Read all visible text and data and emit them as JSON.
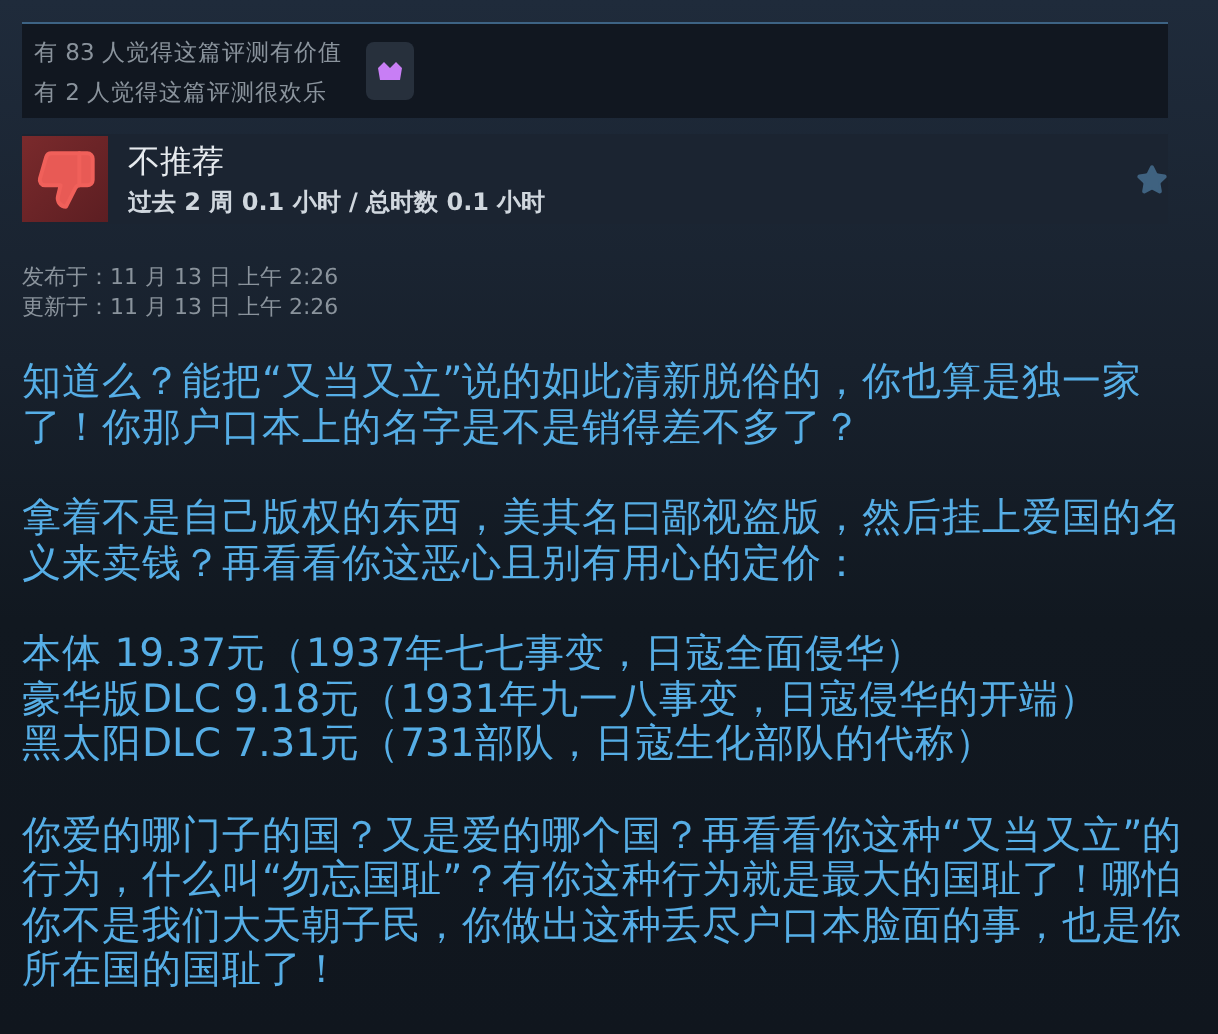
{
  "awards": {
    "helpful": "有 83 人觉得这篇评测有价值",
    "funny": "有 2 人觉得这篇评测很欢乐"
  },
  "review": {
    "recommended": false,
    "verdict": "不推荐",
    "hours": "过去 2 周 0.1 小时 / 总时数 0.1 小时"
  },
  "dates": {
    "posted": "发布于：11 月 13 日 上午 2:26",
    "updated": "更新于：11 月 13 日 上午 2:26"
  },
  "body": [
    {
      "kind": "text",
      "text": "知道么？能把“又当又立”说的如此清新脱俗的，你也算是独一家了！你那户口本上的名字是不是销得差不多了？"
    },
    {
      "kind": "text",
      "text": "拿着不是自己版权的东西，美其名曰鄙视盗版，然后挂上爱国的名义来卖钱？再看看你这恶心且别有用心的定价："
    },
    {
      "kind": "lines",
      "lines": [
        "本体 19.37元（1937年七七事变，日寇全面侵华）",
        "豪华版DLC 9.18元（1931年九一八事变，日寇侵华的开端）",
        "黑太阳DLC 7.31元（731部队，日寇生化部队的代称）"
      ]
    },
    {
      "kind": "text",
      "text": "你爱的哪门子的国？又是爱的哪个国？再看看你这种“又当又立”的行为，什么叫“勿忘国耻”？有你这种行为就是最大的国耻了！哪怕你不是我们大天朝子民，你做出这种丢尽户口本脸面的事，也是你所在国的国耻了！"
    }
  ]
}
